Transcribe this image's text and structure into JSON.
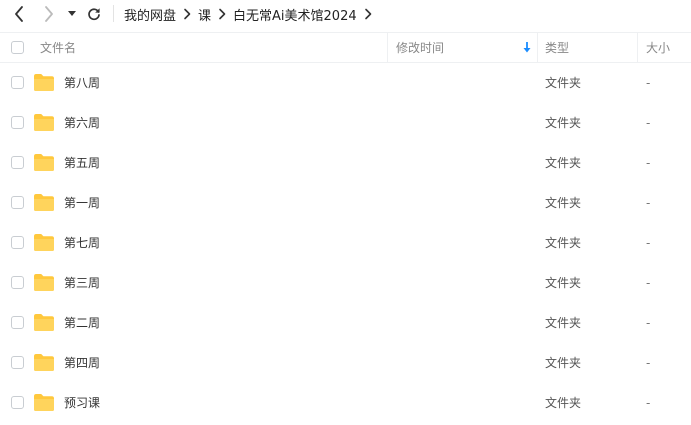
{
  "breadcrumb": [
    "我的网盘",
    "课",
    "白无常Ai美术馆2024"
  ],
  "columns": {
    "name": "文件名",
    "modified": "修改时间",
    "type": "类型",
    "size": "大小"
  },
  "sort": {
    "column": "modified",
    "direction": "desc",
    "icon": "arrow-down-icon",
    "color": "#1a8cff"
  },
  "files": [
    {
      "name": "第八周",
      "modified": "",
      "type": "文件夹",
      "size": "-"
    },
    {
      "name": "第六周",
      "modified": "",
      "type": "文件夹",
      "size": "-"
    },
    {
      "name": "第五周",
      "modified": "",
      "type": "文件夹",
      "size": "-"
    },
    {
      "name": "第一周",
      "modified": "",
      "type": "文件夹",
      "size": "-"
    },
    {
      "name": "第七周",
      "modified": "",
      "type": "文件夹",
      "size": "-"
    },
    {
      "name": "第三周",
      "modified": "",
      "type": "文件夹",
      "size": "-"
    },
    {
      "name": "第二周",
      "modified": "",
      "type": "文件夹",
      "size": "-"
    },
    {
      "name": "第四周",
      "modified": "",
      "type": "文件夹",
      "size": "-"
    },
    {
      "name": "预习课",
      "modified": "",
      "type": "文件夹",
      "size": "-"
    }
  ],
  "folder_color": "#ffc83d"
}
